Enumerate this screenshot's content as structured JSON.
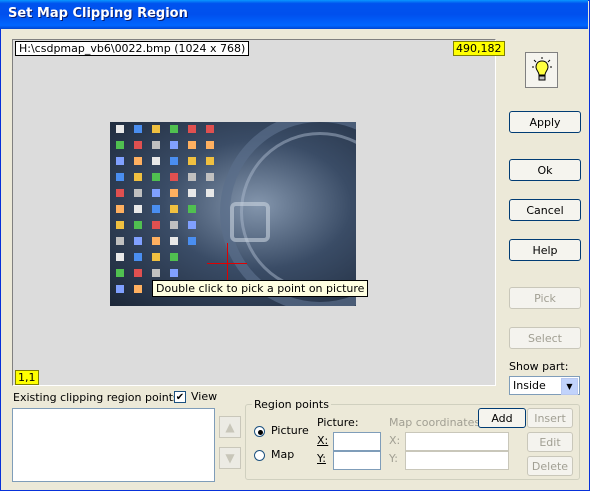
{
  "window": {
    "title": "Set Map Clipping Region"
  },
  "canvas": {
    "path_label": "H:\\csdpmap_vb6\\0022.bmp (1024 x 768)",
    "cursor_coord": "490,182",
    "corner_coord": "1,1",
    "tooltip": "Double click to pick a point on picture"
  },
  "buttons": {
    "apply": "Apply",
    "ok": "Ok",
    "cancel": "Cancel",
    "help": "Help",
    "pick": "Pick",
    "select": "Select",
    "add": "Add",
    "insert": "Insert",
    "edit": "Edit",
    "delete": "Delete"
  },
  "show_part": {
    "label": "Show part:",
    "value": "Inside"
  },
  "existing": {
    "label": "Existing clipping region points:",
    "view_label": "View",
    "view_checked": true
  },
  "region_points": {
    "group_label": "Region points",
    "picture_radio": "Picture",
    "map_radio": "Map",
    "picture_label": "Picture:",
    "map_coords_label": "Map coordinates:",
    "x_label": "X:",
    "y_label": "Y:",
    "map_x_label": "X:",
    "map_y_label": "Y:"
  },
  "colors": {
    "title_blue": "#0054e3",
    "coord_highlight": "#ffff00",
    "crosshair": "#e00000"
  },
  "icons": {
    "hint": "lightbulb-icon",
    "up": "up-arrow-icon",
    "down": "down-arrow-icon",
    "dropdown": "chevron-down-icon"
  }
}
